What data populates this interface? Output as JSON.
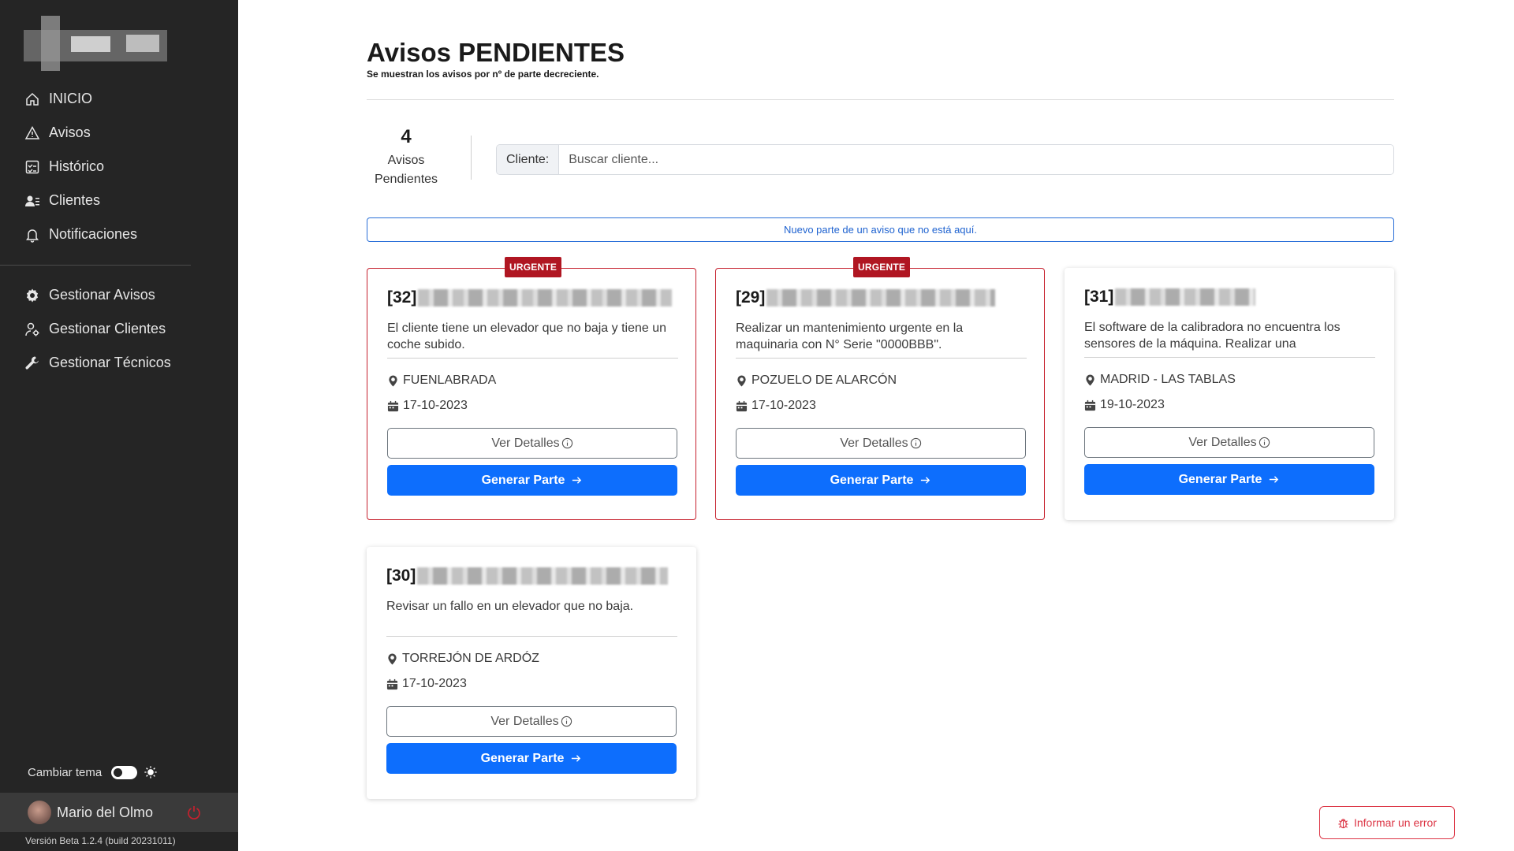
{
  "sidebar": {
    "nav": [
      {
        "label": "INICIO",
        "icon": "home-icon"
      },
      {
        "label": "Avisos",
        "icon": "warning-icon"
      },
      {
        "label": "Histórico",
        "icon": "checklist-icon"
      },
      {
        "label": "Clientes",
        "icon": "people-icon"
      },
      {
        "label": "Notificaciones",
        "icon": "bell-icon"
      }
    ],
    "admin": [
      {
        "label": "Gestionar Avisos",
        "icon": "gear-icon"
      },
      {
        "label": "Gestionar Clientes",
        "icon": "person-gear-icon"
      },
      {
        "label": "Gestionar Técnicos",
        "icon": "wrench-icon"
      }
    ],
    "theme_label": "Cambiar tema",
    "user_name": "Mario del Olmo",
    "version": "Versión Beta 1.2.4 (build 20231011)"
  },
  "main": {
    "title": "Avisos PENDIENTES",
    "subtitle": "Se muestran los avisos por nº de parte decreciente.",
    "count": "4",
    "count_label_1": "Avisos",
    "count_label_2": "Pendientes",
    "search_label": "Cliente:",
    "search_placeholder": "Buscar cliente...",
    "new_link": "Nuevo parte de un aviso que no está aquí.",
    "cards": [
      {
        "id": "[32]",
        "urgent": true,
        "badge": "URGENTE",
        "description": "El cliente tiene un elevador que no baja y tiene un coche subido.",
        "location": "FUENLABRADA",
        "date": "17-10-2023",
        "details_label": "Ver Detalles",
        "generate_label": "Generar Parte"
      },
      {
        "id": "[29]",
        "urgent": true,
        "badge": "URGENTE",
        "description": "Realizar un mantenimiento urgente en la maquinaria con N° Serie \"0000BBB\".",
        "location": "POZUELO DE ALARCÓN",
        "date": "17-10-2023",
        "details_label": "Ver Detalles",
        "generate_label": "Generar Parte"
      },
      {
        "id": "[31]",
        "urgent": false,
        "badge": "",
        "description": "El software de la calibradora no encuentra los sensores de la máquina. Realizar una",
        "location": "MADRID - LAS TABLAS",
        "date": "19-10-2023",
        "details_label": "Ver Detalles",
        "generate_label": "Generar Parte"
      },
      {
        "id": "[30]",
        "urgent": false,
        "badge": "",
        "description": "Revisar un fallo en un elevador que no baja.",
        "location": "TORREJÓN DE ARDÓZ",
        "date": "17-10-2023",
        "details_label": "Ver Detalles",
        "generate_label": "Generar Parte"
      }
    ],
    "report_label": "Informar un error"
  },
  "colors": {
    "sidebar_bg": "#252525",
    "primary": "#0d6efd",
    "urgent": "#b01622",
    "danger": "#dc3545"
  }
}
